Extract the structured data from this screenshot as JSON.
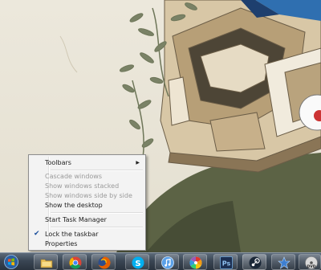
{
  "context_menu": {
    "toolbars": "Toolbars",
    "cascade": "Cascade windows",
    "stacked": "Show windows stacked",
    "side_by_side": "Show windows side by side",
    "show_desktop": "Show the desktop",
    "task_manager": "Start Task Manager",
    "lock_taskbar": "Lock the taskbar",
    "properties": "Properties"
  },
  "taskbar": {
    "pinned": [
      {
        "name": "windows-explorer",
        "icon": "folder-icon"
      },
      {
        "name": "google-chrome",
        "icon": "chrome-icon"
      },
      {
        "name": "firefox",
        "icon": "firefox-icon"
      },
      {
        "name": "skype",
        "icon": "skype-icon"
      },
      {
        "name": "itunes",
        "icon": "music-note-icon"
      },
      {
        "name": "picasa",
        "icon": "pinwheel-icon"
      },
      {
        "name": "photoshop",
        "icon": "photoshop-icon",
        "label": "Ps"
      },
      {
        "name": "steam",
        "icon": "steam-icon"
      },
      {
        "name": "starcraft",
        "icon": "starcraft-icon"
      },
      {
        "name": "dvd-player",
        "icon": "dvd-icon",
        "label": "DVD"
      }
    ]
  },
  "colors": {
    "menu_bg": "#f3f3f3",
    "taskbar": "#3a4654",
    "disabled_text": "#9a9a9a",
    "check": "#1a4f9c"
  }
}
